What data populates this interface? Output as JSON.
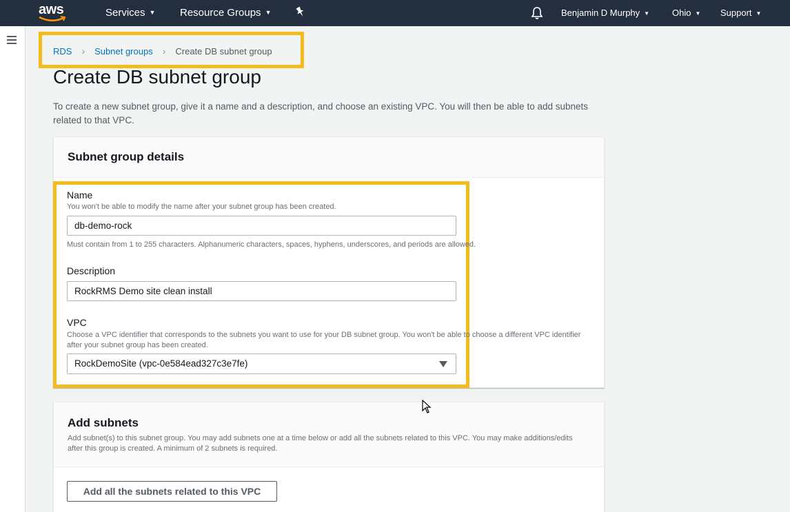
{
  "topnav": {
    "logo_text": "aws",
    "services_label": "Services",
    "resource_groups_label": "Resource Groups",
    "user_label": "Benjamin D Murphy",
    "region_label": "Ohio",
    "support_label": "Support"
  },
  "breadcrumb": {
    "items": [
      "RDS",
      "Subnet groups"
    ],
    "current": "Create DB subnet group"
  },
  "page": {
    "title": "Create DB subnet group",
    "description": "To create a new subnet group, give it a name and a description, and choose an existing VPC. You will then be able to add subnets related to that VPC."
  },
  "details_panel": {
    "title": "Subnet group details",
    "name": {
      "label": "Name",
      "hint": "You won't be able to modify the name after your subnet group has been created.",
      "value": "db-demo-rock",
      "constraint": "Must contain from 1 to 255 characters. Alphanumeric characters, spaces, hyphens, underscores, and periods are allowed."
    },
    "description": {
      "label": "Description",
      "value": "RockRMS Demo site clean install"
    },
    "vpc": {
      "label": "VPC",
      "hint": "Choose a VPC identifier that corresponds to the subnets you want to use for your DB subnet group. You won't be able to choose a different VPC identifier after your subnet group has been created.",
      "selected": "RockDemoSite (vpc-0e584ead327c3e7fe)"
    }
  },
  "subnets_panel": {
    "title": "Add subnets",
    "description": "Add subnet(s) to this subnet group. You may add subnets one at a time below or add all the subnets related to this VPC. You may make additions/edits after this group is created. A minimum of 2 subnets is required.",
    "add_all_button": "Add all the subnets related to this VPC"
  },
  "colors": {
    "nav_bg": "#232f3e",
    "link": "#0073bb",
    "highlight": "#f4bc1b",
    "logo_smile": "#ff9900"
  }
}
